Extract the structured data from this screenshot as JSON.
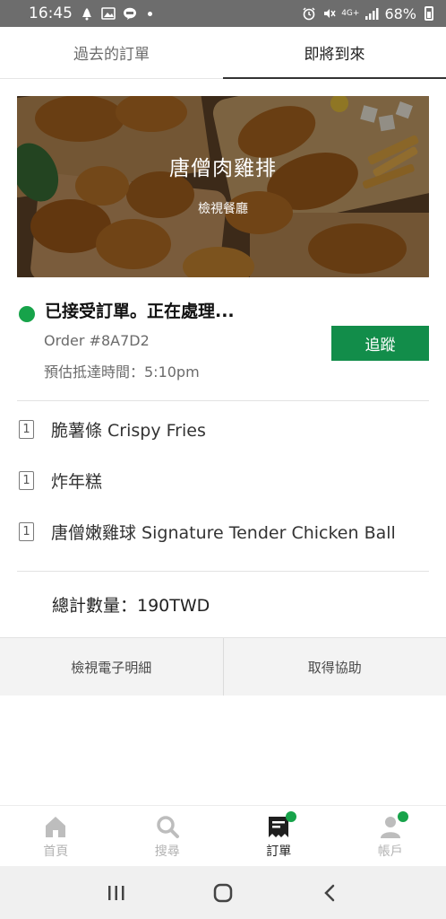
{
  "status_bar": {
    "time": "16:45",
    "network": "4G+",
    "battery": "68%",
    "icons": [
      "notification-icon",
      "image-icon",
      "line-icon",
      "alarm-icon",
      "mute-icon",
      "signal-icon",
      "battery-icon"
    ]
  },
  "tabs": [
    {
      "label": "過去的訂單",
      "active": false
    },
    {
      "label": "即將到來",
      "active": true
    }
  ],
  "restaurant": {
    "name": "唐僧肉雞排",
    "view_link": "檢視餐廳"
  },
  "order": {
    "status_text": "已接受訂單。正在處理...",
    "status_color": "#17a34a",
    "order_number": "Order #8A7D2",
    "eta": "預估抵達時間：5:10pm",
    "track_label": "追蹤",
    "track_color": "#128d4a"
  },
  "items": [
    {
      "qty": "1",
      "name": "脆薯條 Crispy Fries"
    },
    {
      "qty": "1",
      "name": "炸年糕"
    },
    {
      "qty": "1",
      "name": "唐僧嫩雞球 Signature Tender Chicken Ball"
    }
  ],
  "total": "總計數量：190TWD",
  "actions": {
    "receipt_label": "檢視電子明細",
    "help_label": "取得協助"
  },
  "bottom_nav": [
    {
      "label": "首頁",
      "icon": "home-icon",
      "active": false,
      "badge": false
    },
    {
      "label": "搜尋",
      "icon": "search-icon",
      "active": false,
      "badge": false
    },
    {
      "label": "訂單",
      "icon": "receipt-icon",
      "active": true,
      "badge": true
    },
    {
      "label": "帳戶",
      "icon": "account-icon",
      "active": false,
      "badge": true
    }
  ],
  "system_nav": {
    "icons": [
      "recents-icon",
      "home-button-icon",
      "back-icon"
    ]
  }
}
